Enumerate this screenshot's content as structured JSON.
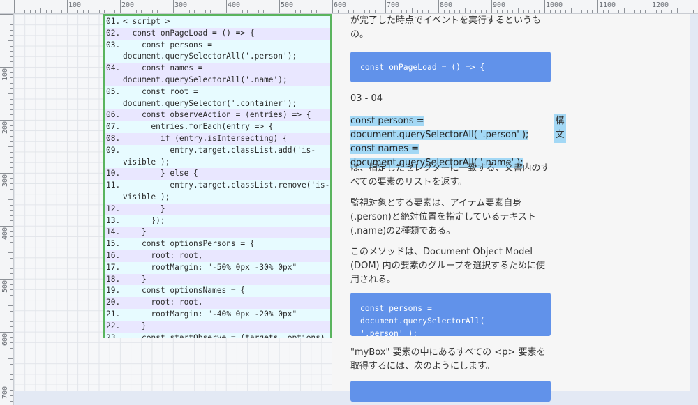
{
  "ruler": {
    "top_labels": [
      "100",
      "200",
      "300",
      "400",
      "500",
      "600",
      "700",
      "800",
      "900",
      "1000",
      "1100",
      "1200"
    ],
    "left_labels": [
      "100",
      "200",
      "300",
      "400",
      "500",
      "600",
      "700"
    ]
  },
  "code": {
    "lines": [
      {
        "n": "01.",
        "t": "< script >"
      },
      {
        "n": "02.",
        "t": "  const onPageLoad = () => {"
      },
      {
        "n": "03.",
        "t": "    const persons =\ndocument.querySelectorAll('.person');"
      },
      {
        "n": "04.",
        "t": "    const names =\ndocument.querySelectorAll('.name');"
      },
      {
        "n": "05.",
        "t": "    const root =\ndocument.querySelector('.container');"
      },
      {
        "n": "06.",
        "t": "    const observeAction = (entries) => {"
      },
      {
        "n": "07.",
        "t": "      entries.forEach(entry => {"
      },
      {
        "n": "08.",
        "t": "        if (entry.isIntersecting) {"
      },
      {
        "n": "09.",
        "t": "          entry.target.classList.add('is-\nvisible');"
      },
      {
        "n": "10.",
        "t": "        } else {"
      },
      {
        "n": "11.",
        "t": "          entry.target.classList.remove('is-\nvisible');"
      },
      {
        "n": "12.",
        "t": "        }"
      },
      {
        "n": "13.",
        "t": "      });"
      },
      {
        "n": "14.",
        "t": "    }"
      },
      {
        "n": "15.",
        "t": "    const optionsPersons = {"
      },
      {
        "n": "16.",
        "t": "      root: root,"
      },
      {
        "n": "17.",
        "t": "      rootMargin: \"-50% 0px -30% 0px\""
      },
      {
        "n": "18.",
        "t": "    }"
      },
      {
        "n": "19.",
        "t": "    const optionsNames = {"
      },
      {
        "n": "20.",
        "t": "      root: root,"
      },
      {
        "n": "21.",
        "t": "      rootMargin: \"-40% 0px -20% 0px\""
      },
      {
        "n": "22.",
        "t": "    }"
      },
      {
        "n": "23.",
        "t": "    const startObserve = (targets, options) => {"
      }
    ]
  },
  "article": {
    "intro": "が完了した時点でイベントを実行するというもの。",
    "code_box_1": "const onPageLoad = () => {",
    "section_label": "03 - 04",
    "highlight": "const persons = document.querySelectorAll( '.person' ); const names = document.querySelectorAll( '.name' );",
    "side_note": "構文",
    "para_1": "は、指定したセレクターに一致する、文書内のすべての要素のリストを返す。",
    "para_2": "監視対象とする要素は、アイテム要素自身(.person)と絶対位置を指定しているテキスト(.name)の2種類である。",
    "para_3": "このメソッドは、Document Object Model (DOM) 内の要素のグループを選択するために使用される。",
    "code_box_2": "const persons = document.querySelectorAll(\n'.person' );",
    "para_4": "\"myBox\" 要素の中にあるすべての <p> 要素を取得するには、次のようにします。"
  }
}
